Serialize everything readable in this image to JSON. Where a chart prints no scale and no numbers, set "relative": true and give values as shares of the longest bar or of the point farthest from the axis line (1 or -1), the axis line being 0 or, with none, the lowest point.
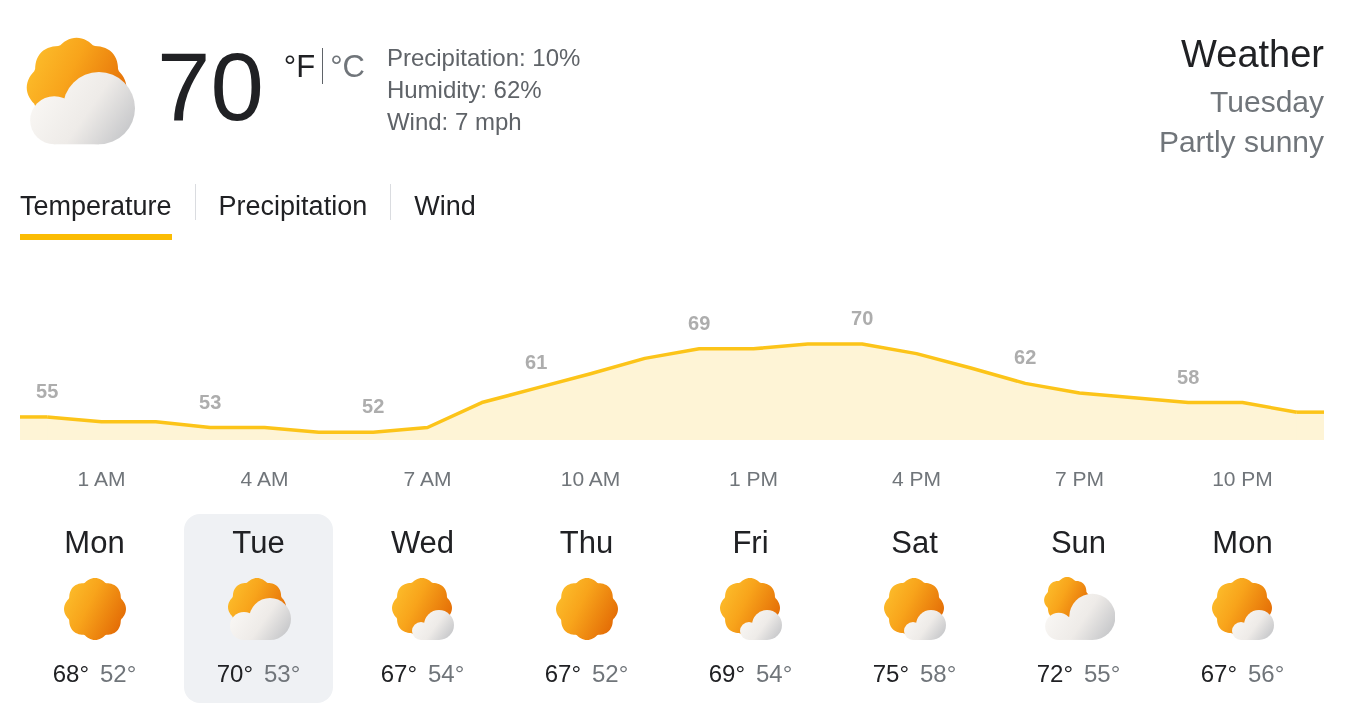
{
  "current": {
    "kind": "partly_sunny",
    "temperature": "70",
    "units": [
      {
        "label": "°F",
        "selected": true
      },
      {
        "label": "°C",
        "selected": false
      }
    ],
    "details": [
      "Precipitation: 10%",
      "Humidity: 62%",
      "Wind: 7 mph"
    ]
  },
  "header": {
    "title": "Weather",
    "day": "Tuesday",
    "condition": "Partly sunny"
  },
  "tabs": [
    {
      "label": "Temperature",
      "selected": true
    },
    {
      "label": "Precipitation",
      "selected": false
    },
    {
      "label": "Wind",
      "selected": false
    }
  ],
  "chart": {
    "chart_data": {
      "type": "area",
      "relative": true,
      "categories": [
        null,
        "1 AM",
        null,
        null,
        "4 AM",
        null,
        null,
        "7 AM",
        null,
        null,
        "10 AM",
        null,
        null,
        "1 PM",
        null,
        null,
        "4 PM",
        null,
        null,
        "7 PM",
        null,
        null,
        "10 PM",
        null
      ],
      "series": [
        {
          "color": "#fcc419",
          "values": [
            0.24,
            0.19,
            0.19,
            0.13,
            0.13,
            0.08,
            0.08,
            0.13,
            0.39,
            0.54,
            0.69,
            0.85,
            0.95,
            0.95,
            1,
            1,
            0.9,
            0.75,
            0.59,
            0.49,
            0.44,
            0.39,
            0.39,
            0.29
          ]
        }
      ],
      "value_labels": [
        "55",
        null,
        null,
        "53",
        null,
        null,
        "52",
        null,
        null,
        "61",
        null,
        null,
        "69",
        null,
        null,
        "70",
        null,
        null,
        "62",
        null,
        null,
        "58",
        null,
        null
      ]
    }
  },
  "forecast": [
    {
      "day": "Mon",
      "kind": "sunny",
      "high": "68°",
      "low": "52°",
      "selected": false
    },
    {
      "day": "Tue",
      "kind": "partly_sunny",
      "high": "70°",
      "low": "53°",
      "selected": true
    },
    {
      "day": "Wed",
      "kind": "mostly_sunny",
      "high": "67°",
      "low": "54°",
      "selected": false
    },
    {
      "day": "Thu",
      "kind": "sunny",
      "high": "67°",
      "low": "52°",
      "selected": false
    },
    {
      "day": "Fri",
      "kind": "mostly_sunny",
      "high": "69°",
      "low": "54°",
      "selected": false
    },
    {
      "day": "Sat",
      "kind": "mostly_sunny",
      "high": "75°",
      "low": "58°",
      "selected": false
    },
    {
      "day": "Sun",
      "kind": "mostly_cloudy",
      "high": "72°",
      "low": "55°",
      "selected": false
    },
    {
      "day": "Mon",
      "kind": "mostly_sunny",
      "high": "67°",
      "low": "56°",
      "selected": false
    }
  ]
}
